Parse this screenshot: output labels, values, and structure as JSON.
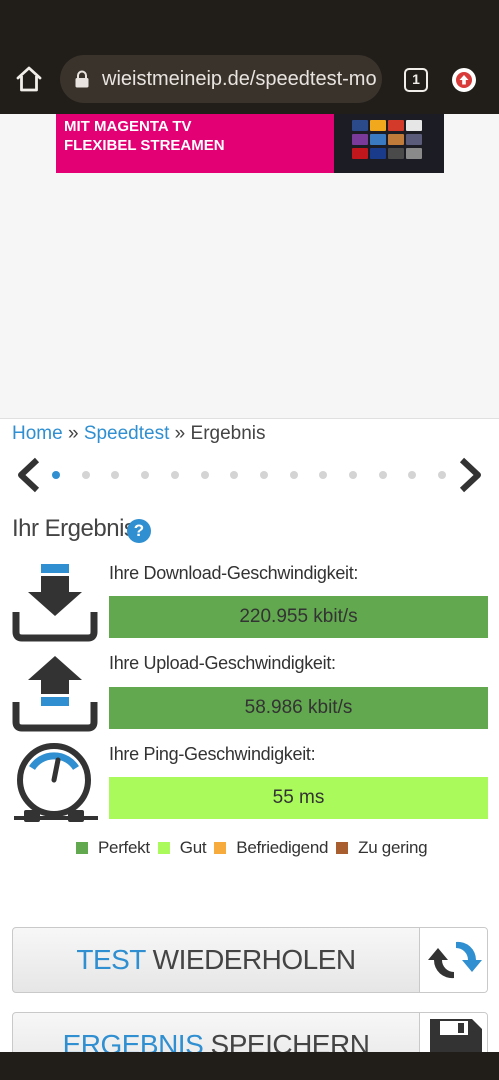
{
  "browser": {
    "url": "wieistmeineip.de/speedtest-mo",
    "tab_count": "1",
    "icons": [
      "home-icon",
      "lock-icon",
      "tab-switcher-icon",
      "extension-icon"
    ]
  },
  "ad": {
    "line1": "MIT MAGENTA TV",
    "line2": "FLEXIBEL STREAMEN",
    "brand_color": "#e20074"
  },
  "breadcrumb": {
    "home": "Home",
    "sep1": " » ",
    "speedtest": "Speedtest",
    "sep2": " » ",
    "current": "Ergebnis"
  },
  "carousel": {
    "dot_count": 14,
    "active_index": 0
  },
  "result": {
    "title": "Ihr Ergebnis",
    "help": "?",
    "download": {
      "label": "Ihre Download-Geschwindigkeit:",
      "value": "220.955 kbit/s",
      "color": "#62a84f"
    },
    "upload": {
      "label": "Ihre Upload-Geschwindigkeit:",
      "value": "58.986 kbit/s",
      "color": "#62a84f"
    },
    "ping": {
      "label": "Ihre Ping-Geschwindigkeit:",
      "value": "55 ms",
      "color": "#a9fa5a"
    }
  },
  "legend": [
    {
      "label": "Perfekt",
      "color": "#62a84f"
    },
    {
      "label": "Gut",
      "color": "#a9fa5a"
    },
    {
      "label": "Befriedigend",
      "color": "#f6ab3c"
    },
    {
      "label": "Zu gering",
      "color": "#a95e30"
    }
  ],
  "buttons": {
    "repeat": {
      "accent": "TEST",
      "rest": " WIEDERHOLEN"
    },
    "save": {
      "accent": "ERGEBNIS",
      "rest": " SPEICHERN"
    }
  }
}
